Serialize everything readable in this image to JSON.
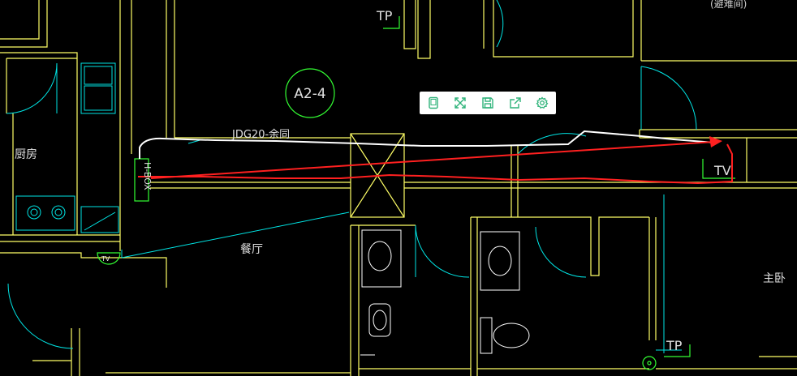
{
  "drawing": {
    "labels": {
      "room_tag": "A2-4",
      "pipe_label": "JDG20-余同",
      "kitchen": "厨房",
      "dining": "餐厅",
      "master_bedroom": "主卧",
      "refuge_room": "(避难间)",
      "tp_top": "TP",
      "tp_bottom": "TP",
      "tv_right": "TV",
      "tv_small": "TV",
      "box_label": "H-BOX"
    },
    "colors": {
      "background": "#000000",
      "wall": "#ffff66",
      "cyan": "#00e5e5",
      "green": "#33ff33",
      "white": "#ffffff",
      "red": "#ff2020",
      "text": "#e0e0e0"
    }
  },
  "toolbar": {
    "buttons": [
      {
        "icon": "tablet-icon"
      },
      {
        "icon": "fullscreen-icon"
      },
      {
        "icon": "save-icon"
      },
      {
        "icon": "share-icon"
      },
      {
        "icon": "settings-icon"
      }
    ],
    "icon_color": "#2fb37a"
  }
}
